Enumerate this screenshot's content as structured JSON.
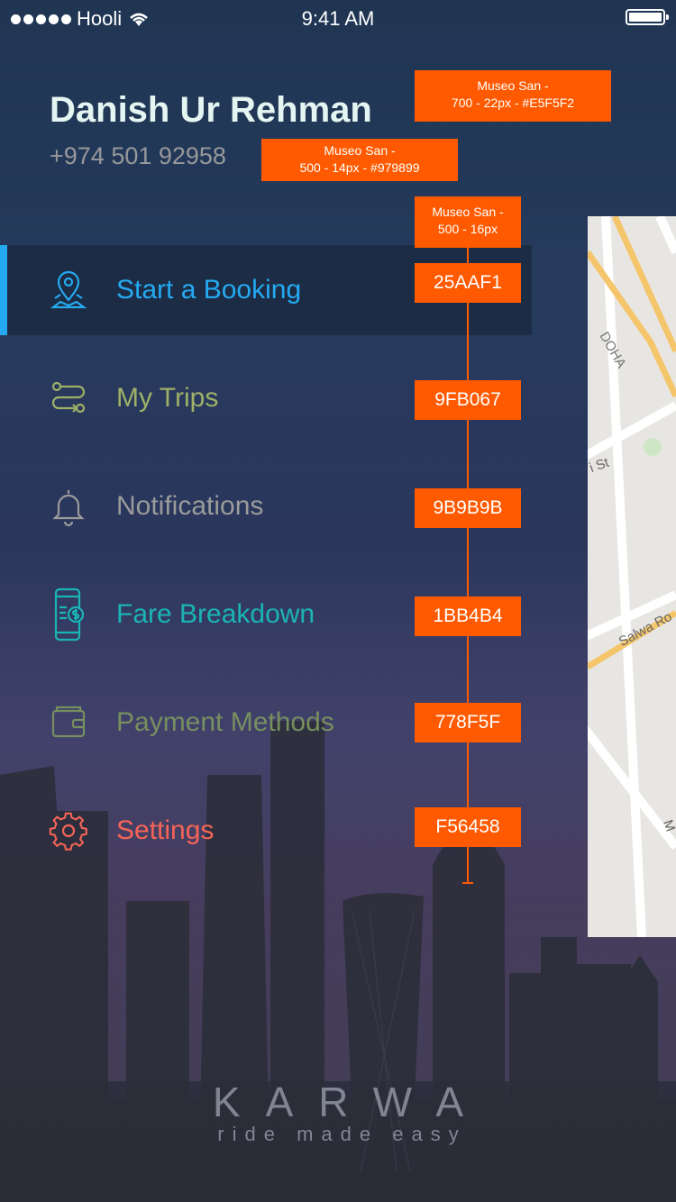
{
  "status_bar": {
    "carrier": "Hooli",
    "time": "9:41 AM"
  },
  "profile": {
    "name": "Danish Ur Rehman",
    "phone": "+974 501 92958"
  },
  "menu": [
    {
      "label": "Start a Booking",
      "color": "#25AAF1",
      "icon": "location-pin-icon",
      "active": true
    },
    {
      "label": "My Trips",
      "color": "#9FB067",
      "icon": "route-icon",
      "active": false
    },
    {
      "label": "Notifications",
      "color": "#9B9B9B",
      "icon": "bell-icon",
      "active": false
    },
    {
      "label": "Fare Breakdown",
      "color": "#1BB4B4",
      "icon": "phone-fare-icon",
      "active": false
    },
    {
      "label": "Payment Methods",
      "color": "#778F5F",
      "icon": "wallet-icon",
      "active": false
    },
    {
      "label": "Settings",
      "color": "#F56458",
      "icon": "gear-icon",
      "active": false
    }
  ],
  "annotations": {
    "name_spec_line1": "Museo San -",
    "name_spec_line2": "700 - 22px - #E5F5F2",
    "phone_spec_line1": "Museo San -",
    "phone_spec_line2": "500 - 14px - #979899",
    "menu_spec_line1": "Museo San -",
    "menu_spec_line2": "500 - 16px",
    "codes": [
      "25AAF1",
      "9FB067",
      "9B9B9B",
      "1BB4B4",
      "778F5F",
      "F56458"
    ]
  },
  "map": {
    "labels": [
      "DOHA",
      "i St",
      "Salwa Ro",
      "M"
    ]
  },
  "logo": {
    "brand": "KARWA",
    "tagline": "ride made easy"
  }
}
